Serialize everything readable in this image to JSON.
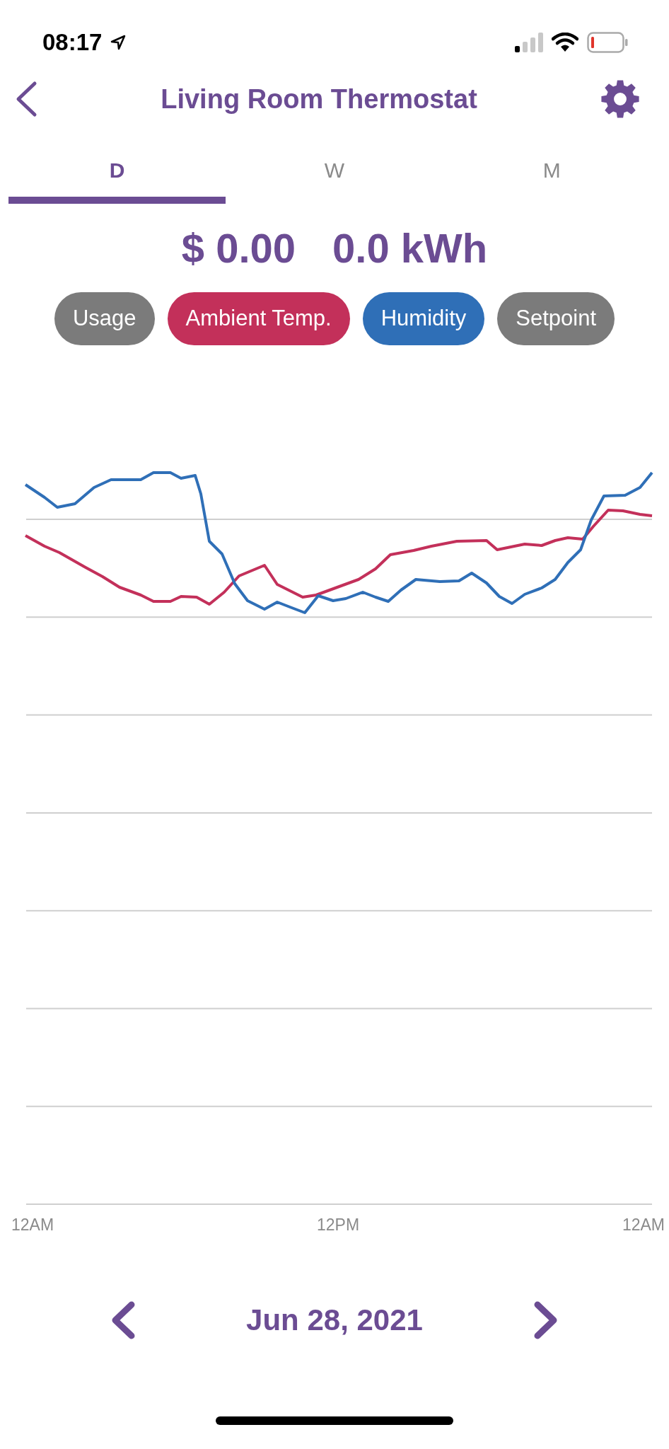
{
  "status_bar": {
    "time": "08:17"
  },
  "header": {
    "title": "Living Room Thermostat"
  },
  "tabs": [
    {
      "label": "D",
      "selected": true
    },
    {
      "label": "W",
      "selected": false
    },
    {
      "label": "M",
      "selected": false
    }
  ],
  "totals": {
    "cost": "$ 0.00",
    "energy": "0.0 kWh"
  },
  "chips": [
    {
      "label": "Usage",
      "on": false
    },
    {
      "label": "Ambient Temp.",
      "on": true,
      "color": "#c3305a"
    },
    {
      "label": "Humidity",
      "on": true,
      "color": "#2f6fb7"
    },
    {
      "label": "Setpoint",
      "on": false
    }
  ],
  "chart": {
    "x_labels": [
      "12AM",
      "12PM",
      "12AM"
    ]
  },
  "date_nav": {
    "date": "Jun 28, 2021"
  }
}
